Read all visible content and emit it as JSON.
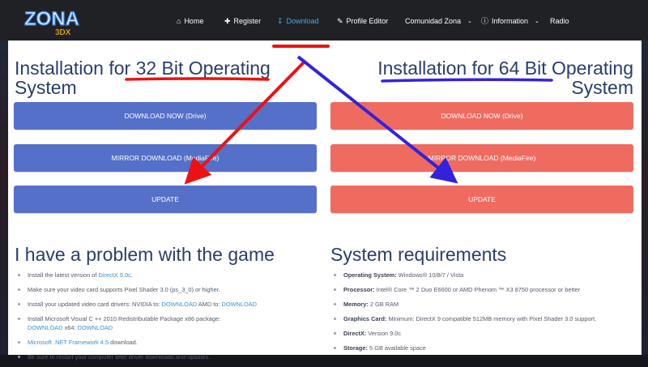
{
  "logo": {
    "text": "ZONA",
    "sub": "3DX"
  },
  "nav": {
    "home": "Home",
    "register": "Register",
    "download": "Download",
    "profile_editor": "Profile Editor",
    "comunidad": "Comunidad Zona",
    "information": "Information",
    "radio": "Radio"
  },
  "left": {
    "title_line1": "Installation for 32 Bit Operating",
    "title_line2": "System",
    "btn_download": "DOWNLOAD NOW (Drive)",
    "btn_mirror": "MIRROR DOWNLOAD (MediaFire)",
    "btn_update": "UPDATE"
  },
  "right": {
    "title_line1": "Installation for 64 Bit Operating",
    "title_line2": "System",
    "btn_download": "DOWNLOAD NOW (Drive)",
    "btn_mirror": "MIRROR DOWNLOAD (MediaFire)",
    "btn_update": "UPDATE"
  },
  "problem": {
    "title": "I have a problem with the game",
    "items": {
      "i1_text": "Install the latest version of ",
      "i1_link": "DirectX 9.0c",
      "i1_end": ".",
      "i2_text": "Make sure your video card supports Pixel Shader 3.0 (ps_3_0) or higher.",
      "i3_text": "Install your updated video card drivers: NVIDIA to: ",
      "i3_link1": "DOWNLOAD",
      "i3_mid": " AMD to: ",
      "i3_link2": "DOWNLOAD",
      "i4_text": "Install Microsoft Visual C ++ 2010 Redistributable Package x86 package:",
      "i4_link1": "DOWNLOAD",
      "i4_mid": " x64: ",
      "i4_link2": "DOWNLOAD",
      "i5_link": "Microsoft .NET Framework 4.5",
      "i5_text": " download.",
      "i6_text": "Be sure to restart your computer after driver downloads and updates."
    }
  },
  "requirements": {
    "title": "System requirements",
    "os_label": "Operating System:",
    "os_value": " Windows® 10/8/7 / Vista",
    "proc_label": "Processor:",
    "proc_value": " Intel® Core ™ 2 Duo E6600 or AMD Phenom ™ X3 8750 processor or better",
    "mem_label": "Memory:",
    "mem_value": " 2 GB RAM",
    "gpu_label": "Graphics Card:",
    "gpu_value": " Minimum: DirectX 9 compatible 512MB memory with Pixel Shader 3.0 support.",
    "dx_label": "DirectX:",
    "dx_value": " Version 9.0c",
    "storage_label": "Storage:",
    "storage_value": " 5 GB available space"
  },
  "colors": {
    "nav_bg": "#202125",
    "active": "#4aa8e8",
    "heading": "#2a3d6b",
    "btn_blue": "#5570c8",
    "btn_red": "#ef6b60",
    "annot_red": "#ee1111",
    "annot_blue": "#3322dd"
  }
}
